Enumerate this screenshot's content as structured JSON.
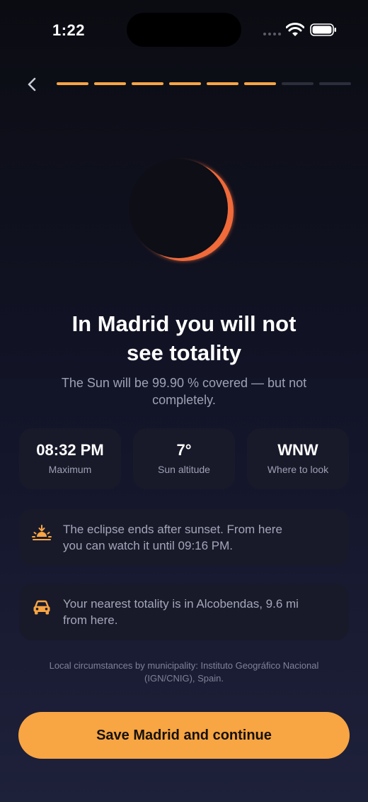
{
  "status_bar": {
    "time": "1:22"
  },
  "progress": {
    "total_steps": 8,
    "completed_steps": 6,
    "active_color": "#f8a544",
    "inactive_color": "#2c2e3b"
  },
  "colors": {
    "accent": "#f8a544",
    "crescent": "#f06a3a"
  },
  "hero": {
    "title_line1": "In Madrid you will not",
    "title_line2": "see totality",
    "subtitle_line1": "The Sun will be 99.90 % covered — but not",
    "subtitle_line2": "completely."
  },
  "stats": [
    {
      "value": "08:32 PM",
      "label": "Maximum"
    },
    {
      "value": "7°",
      "label": "Sun altitude"
    },
    {
      "value": "WNW",
      "label": "Where to look"
    }
  ],
  "info_cards": [
    {
      "icon": "sunset-icon",
      "line1": "The eclipse ends after sunset. From here",
      "line2": "you can watch it until 09:16 PM."
    },
    {
      "icon": "car-icon",
      "line1": "Your nearest totality is in Alcobendas, 9.6 mi",
      "line2": "from here."
    }
  ],
  "attribution": {
    "line1": "Local circumstances by municipality: Instituto Geográfico Nacional",
    "line2": "(IGN/CNIG), Spain."
  },
  "cta": {
    "label": "Save Madrid and continue"
  }
}
